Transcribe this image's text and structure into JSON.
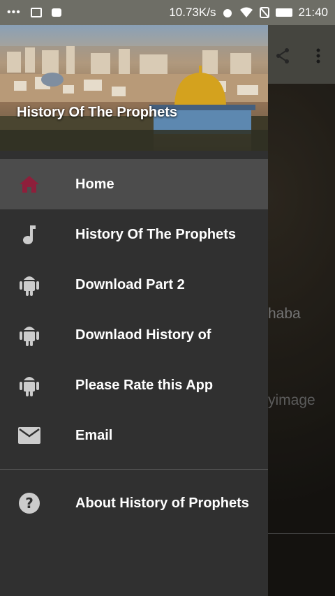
{
  "status_bar": {
    "notif_dots": "•••",
    "speed": "10.73K/s",
    "time": "21:40"
  },
  "drawer": {
    "header_title": "History Of The Prophets",
    "items": [
      {
        "label": "Home",
        "icon": "home-icon"
      },
      {
        "label": "History Of The Prophets",
        "icon": "music-note-icon"
      },
      {
        "label": "Download Part 2",
        "icon": "android-icon"
      },
      {
        "label": "Downlaod History of",
        "icon": "android-icon"
      },
      {
        "label": "Please Rate this App",
        "icon": "android-icon"
      },
      {
        "label": "Email",
        "icon": "email-icon"
      }
    ],
    "footer_items": [
      {
        "label": "About History of Prophets",
        "icon": "help-icon"
      }
    ]
  },
  "background": {
    "text_1": "haba",
    "text_2": "yimage"
  },
  "colors": {
    "drawer_bg": "#303030",
    "active_bg": "#4c4c4c",
    "home_icon": "#8e1f3b",
    "icon_gray": "#cccccc",
    "status_bar": "#6e6e66"
  }
}
